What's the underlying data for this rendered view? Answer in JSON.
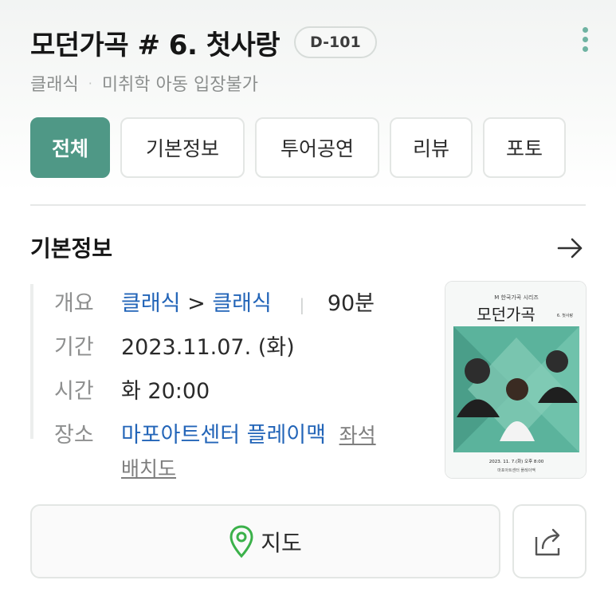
{
  "header": {
    "title": "모던가곡 # 6. 첫사랑",
    "dday": "D-101",
    "genre": "클래식",
    "separator": "·",
    "age": "미취학 아동 입장불가"
  },
  "tabs": [
    {
      "label": "전체",
      "active": true
    },
    {
      "label": "기본정보",
      "active": false
    },
    {
      "label": "투어공연",
      "active": false
    },
    {
      "label": "리뷰",
      "active": false
    },
    {
      "label": "포토",
      "active": false
    }
  ],
  "basic_info": {
    "section_title": "기본정보",
    "overview_label": "개요",
    "genre_main": "클래식",
    "genre_arrow": ">",
    "genre_sub": "클래식",
    "duration": "90분",
    "period_label": "기간",
    "period": "2023.11.07. (화)",
    "time_label": "시간",
    "time": "화 20:00",
    "venue_label": "장소",
    "venue": "마포아트센터 플레이맥",
    "seat_map_part1": "좌석",
    "seat_map_part2": "배치도"
  },
  "poster": {
    "series": "M 한국가곡 시리즈",
    "title": "모던가곡",
    "episode": "6. 첫사랑",
    "date_line": "2023. 11. 7.(화) 오후 8:00",
    "venue_line": "마포아트센터 플레이맥"
  },
  "actions": {
    "map_label": "지도"
  },
  "colors": {
    "accent": "#4f9886",
    "link": "#2365b8",
    "poster_green": "#5bb39c"
  },
  "icons": [
    "more-vertical-icon",
    "arrow-right-icon",
    "map-pin-icon",
    "share-icon"
  ]
}
